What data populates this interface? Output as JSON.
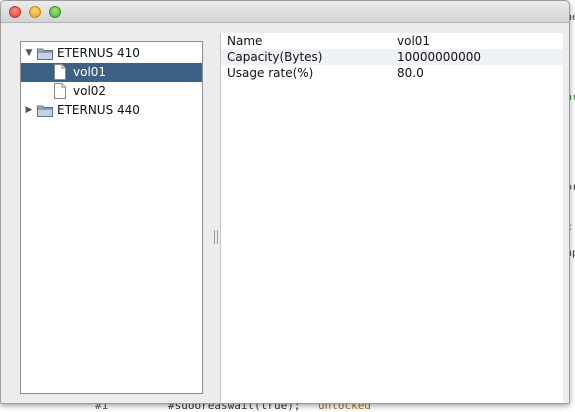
{
  "background": {
    "right_fragments": [
      "ne",
      "ar",
      "or",
      "c",
      "np"
    ],
    "bottom_fragments": [
      "#1",
      "#suooreaswait(true);"
    ],
    "bottom_highlight": "unlocked"
  },
  "window": {
    "traffic_lights": [
      "close",
      "minimize",
      "zoom"
    ]
  },
  "tree": {
    "items": [
      {
        "label": "ETERNUS 410",
        "type": "folder",
        "expanded": true
      },
      {
        "label": "vol01",
        "type": "file",
        "selected": true
      },
      {
        "label": "vol02",
        "type": "file",
        "selected": false
      },
      {
        "label": "ETERNUS 440",
        "type": "folder",
        "expanded": false
      }
    ],
    "expanded_arrow": "▼",
    "collapsed_arrow": "▶"
  },
  "properties": {
    "rows": [
      {
        "name": "Name",
        "value": "vol01"
      },
      {
        "name": "Capacity(Bytes)",
        "value": "10000000000"
      },
      {
        "name": "Usage rate(%)",
        "value": "80.0"
      }
    ]
  },
  "colors": {
    "selection": "#3d6185",
    "row_alt": "#eef1f5",
    "titlebar_top": "#ececec",
    "titlebar_bottom": "#d3d3d3"
  }
}
